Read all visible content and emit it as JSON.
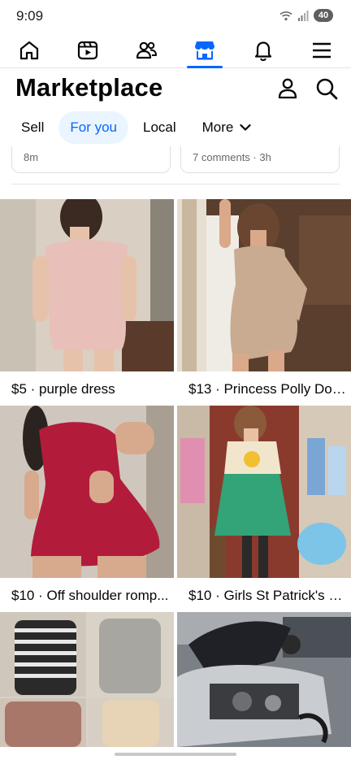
{
  "status_bar": {
    "time": "9:09",
    "battery": "40"
  },
  "nav": {
    "tabs": [
      {
        "name": "home-icon"
      },
      {
        "name": "video-icon"
      },
      {
        "name": "friends-icon"
      },
      {
        "name": "marketplace-icon",
        "active": true
      },
      {
        "name": "notifications-icon"
      },
      {
        "name": "menu-icon"
      }
    ]
  },
  "header": {
    "title": "Marketplace"
  },
  "filters": {
    "sell": "Sell",
    "for_you": "For you",
    "local": "Local",
    "more": "More"
  },
  "previous_cards": {
    "left_meta": "8m",
    "right_meta": "7 comments · 3h"
  },
  "listings": [
    {
      "caption": "$5 · purple dress"
    },
    {
      "caption": "$13 · Princess Polly Don..."
    },
    {
      "caption": "$10 · Off shoulder romp..."
    },
    {
      "caption": "$10 · Girls St Patrick's D..."
    },
    {
      "caption": ""
    },
    {
      "caption": ""
    }
  ],
  "colors": {
    "accent": "#0866ff",
    "pill_bg": "#ebf5ff",
    "text": "#050505",
    "meta": "#65676b"
  }
}
